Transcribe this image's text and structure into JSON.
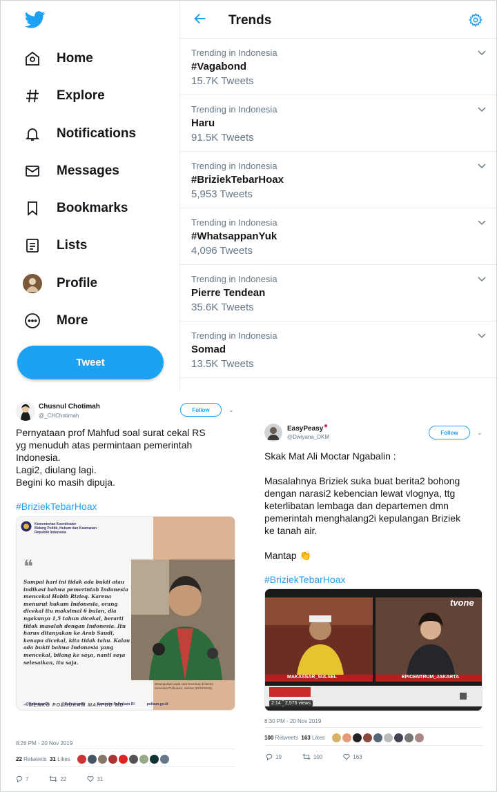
{
  "nav": {
    "items": [
      {
        "label": "Home",
        "icon": "home-icon"
      },
      {
        "label": "Explore",
        "icon": "hashtag-icon"
      },
      {
        "label": "Notifications",
        "icon": "bell-icon"
      },
      {
        "label": "Messages",
        "icon": "mail-icon"
      },
      {
        "label": "Bookmarks",
        "icon": "bookmark-icon"
      },
      {
        "label": "Lists",
        "icon": "list-icon"
      },
      {
        "label": "Profile",
        "icon": "avatar"
      },
      {
        "label": "More",
        "icon": "more-icon"
      }
    ],
    "tweet_label": "Tweet"
  },
  "trends": {
    "title": "Trends",
    "items": [
      {
        "location": "Trending in Indonesia",
        "name": "#Vagabond",
        "count": "15.7K Tweets"
      },
      {
        "location": "Trending in Indonesia",
        "name": "Haru",
        "count": "91.5K Tweets"
      },
      {
        "location": "Trending in Indonesia",
        "name": "#BriziekTebarHoax",
        "count": "5,953 Tweets"
      },
      {
        "location": "Trending in Indonesia",
        "name": "#WhatsappanYuk",
        "count": "4,096 Tweets"
      },
      {
        "location": "Trending in Indonesia",
        "name": "Pierre Tendean",
        "count": "35.6K Tweets"
      },
      {
        "location": "Trending in Indonesia",
        "name": "Somad",
        "count": "13.5K Tweets"
      }
    ]
  },
  "tweet1": {
    "name": "Chusnul Chotimah",
    "handle": "@_CHChotimah",
    "follow_label": "Follow",
    "text": "Pernyataan prof Mahfud soal surat cekal RS\nyg menuduh atas permintaan pemerintah\nIndonesia.\nLagi2, diulang lagi.\nBegini ko masih dipuja.",
    "hashtag": "#BriziekTebarHoax",
    "image": {
      "header": "Kementerian Koordinator\nBidang Politik, Hukum dan Keamanan\nRepublik Indonesia",
      "quote": "Sampai hari ini tidak ada bukti atau indikasi bahwa pemerintah Indonesia mencekal Habib Rizieq. Karena menurut hukum Indonesia, orang dicekal itu maksimal 6 bulan, dia ngakunya 1,5 tahun dicekal, berarti tidak masalah dengan Indonesia. Itu harus ditanyakan ke Arab Saudi, kenapa dicekal, kita tidak tahu. Kalau ada bukti bahwa Indonesia yang mencekal, bilang ke saya, nanti saya selesaikan, itu saja.",
      "attribution": "– MENKO POLHUKAM MAHFUD MD",
      "caption": "Disampaikan pada saat Doorstop di kantor\nKemenko Polhukam, Selasa (12/11/2019).",
      "socials": [
        "@PolhukamRI",
        "@PolhukamRI",
        "Kemenko Polhukam RI",
        "polkam.go.id"
      ]
    },
    "time": "8:26 PM - 20 Nov 2019",
    "retweets": "22",
    "retweets_label": "Retweets",
    "likes": "31",
    "likes_label": "Likes",
    "replies_count": "7",
    "retweet_count": "22",
    "like_count": "31"
  },
  "tweet2": {
    "name": "EasyPeasy",
    "handle": "@Dwiyana_DKM",
    "follow_label": "Follow",
    "text": "Skak Mat Ali Moctar Ngabalin :\n\nMasalahnya Briziek suka buat berita2 bohong\ndengan narasi2 kebencian lewat vlognya, ttg\nketerlibatan lembaga dan departemen dmn\npemerintah menghalang2i kepulangan Briziek\nke tanah air.\n\nMantap 👏",
    "hashtag": "#BriziekTebarHoax",
    "video": {
      "left_caption": "MAKASSAR_SULSEL",
      "right_caption": "EPICENTRUM_JAKARTA",
      "channel": "tvone",
      "duration": "2:14",
      "views": "2,576 views"
    },
    "time": "8:30 PM - 20 Nov 2019",
    "retweets": "100",
    "retweets_label": "Retweets",
    "likes": "163",
    "likes_label": "Likes",
    "replies_count": "19",
    "retweet_count": "100",
    "like_count": "163"
  },
  "colors": {
    "accent": "#1da1f2",
    "muted": "#657786",
    "text": "#14171a",
    "border": "#e6ecf0"
  }
}
